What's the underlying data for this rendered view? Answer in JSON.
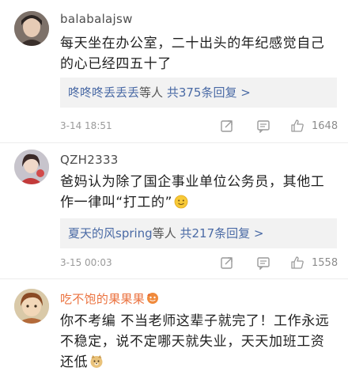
{
  "comments": [
    {
      "username": "balabalajsw",
      "text": "每天坐在办公室，二十出头的年纪感觉自己的心已经四五十了",
      "replies": {
        "who": "咚咚咚丢丢丢",
        "mid": "等人",
        "total": "共375条回复",
        "arrow": ">"
      },
      "time": "3-14 18:51",
      "likes": "1648"
    },
    {
      "username": "QZH2333",
      "text": "爸妈认为除了国企事业单位公务员，其他工作一律叫“打工的”",
      "replies": {
        "who": "夏天的风spring",
        "mid": "等人",
        "total": "共217条回复",
        "arrow": ">"
      },
      "time": "3-15 00:03",
      "likes": "1558"
    },
    {
      "username": "吃不饱的果果果",
      "text": "你不考编 不当老师这辈子就完了！工作永远不稳定，说不定哪天就失业，天天加班工资还低"
    }
  ],
  "icons": {
    "share": "share-icon",
    "comment": "comment-icon",
    "like": "thumbs-up-icon",
    "smile": "smile-emoji-icon",
    "doge": "doge-emoji-icon",
    "badge": "vip-badge-icon"
  },
  "colors": {
    "link": "#4a6aa5",
    "orange_name": "#eb7340",
    "meta": "#9a9a9a",
    "reply_bg": "#f2f2f2"
  }
}
